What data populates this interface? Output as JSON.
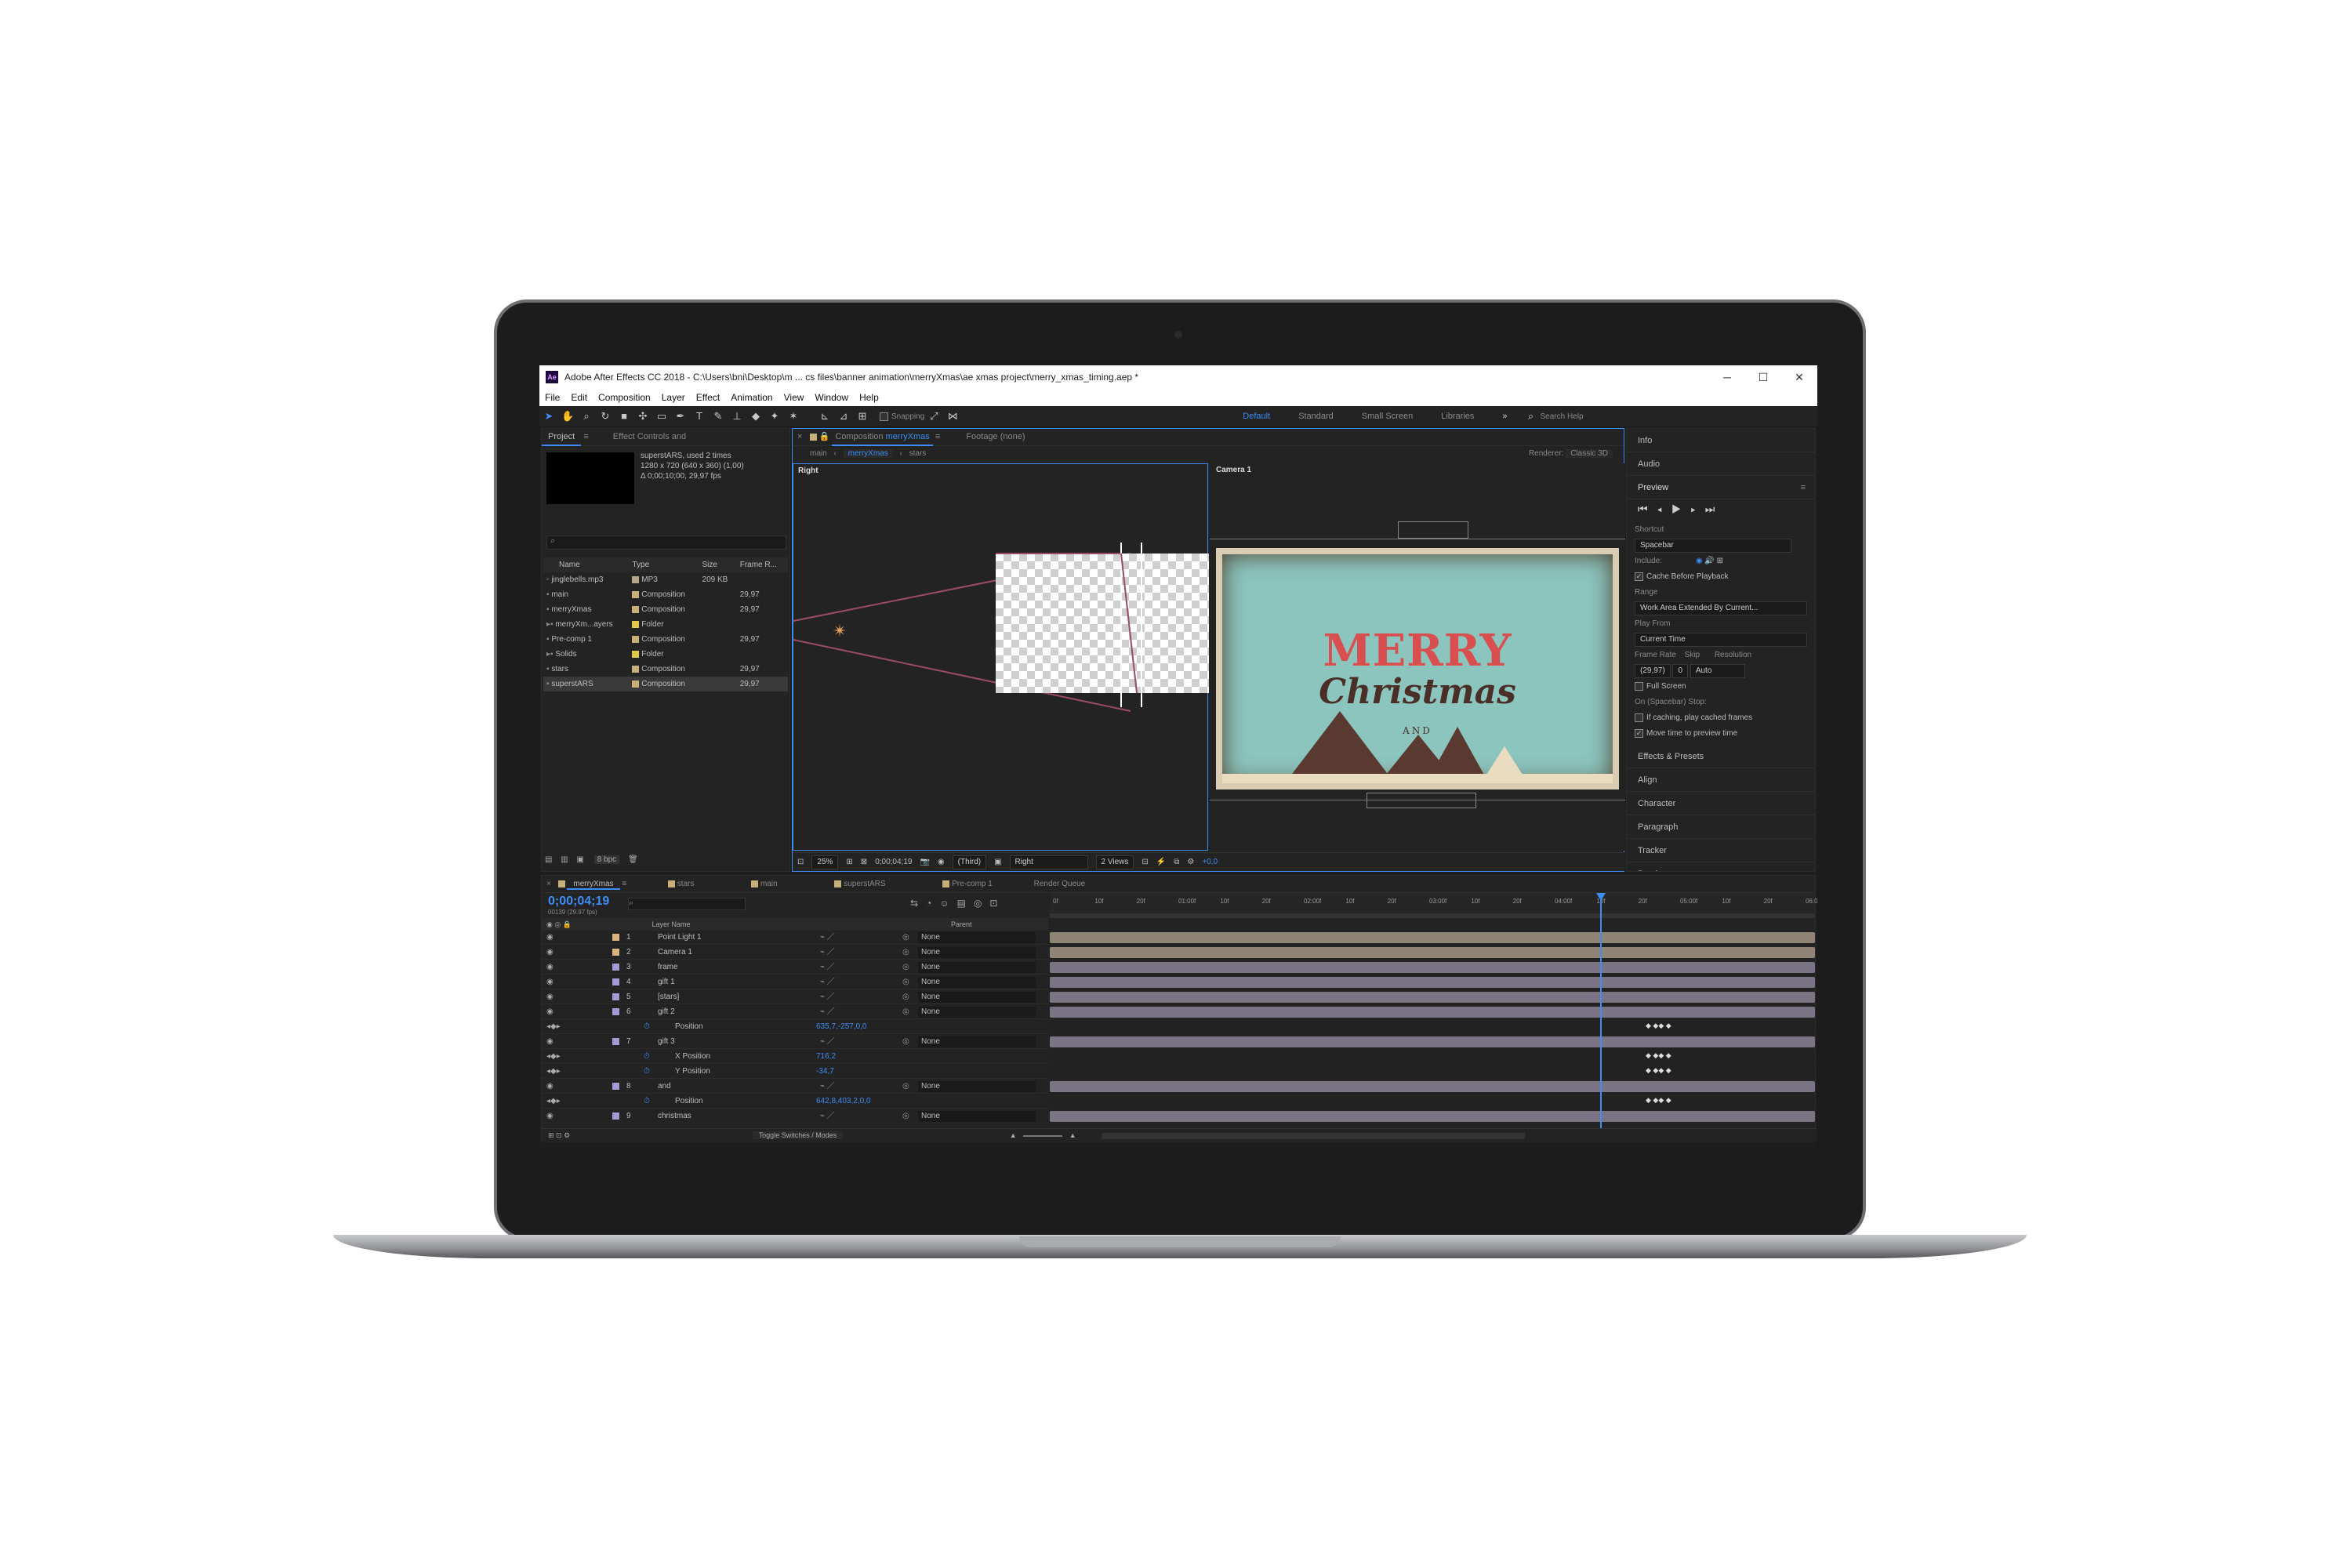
{
  "window": {
    "title": "Adobe After Effects CC 2018 - C:\\Users\\bni\\Desktop\\m ... cs files\\banner animation\\merryXmas\\ae xmas project\\merry_xmas_timing.aep *",
    "logo": "Ae",
    "minimize": "─",
    "maximize": "☐",
    "close": "✕"
  },
  "menu": [
    "File",
    "Edit",
    "Composition",
    "Layer",
    "Effect",
    "Animation",
    "View",
    "Window",
    "Help"
  ],
  "toolbar": {
    "snapping": "Snapping",
    "workspaces": [
      "Default",
      "Standard",
      "Small Screen",
      "Libraries"
    ],
    "more": "»",
    "search": "Search Help"
  },
  "project": {
    "tab": "Project",
    "effect_tab": "Effect Controls and",
    "item_name": "superstARS",
    "item_used": ", used 2 times",
    "item_size": "1280 x 720  (640 x 360) (1,00)",
    "item_dur": "Δ 0;00;10;00, 29,97 fps",
    "search_placeholder": "",
    "columns": [
      "Name",
      "Type",
      "Size",
      "Frame R..."
    ],
    "rows": [
      {
        "name": "jinglebells.mp3",
        "type": "MP3",
        "size": "209 KB",
        "fr": "",
        "color": "#b5a58a"
      },
      {
        "name": "main",
        "type": "Composition",
        "size": "",
        "fr": "29,97",
        "color": "#c9b07a"
      },
      {
        "name": "merryXmas",
        "type": "Composition",
        "size": "",
        "fr": "29,97",
        "color": "#c9b07a"
      },
      {
        "name": "merryXm...ayers",
        "type": "Folder",
        "size": "",
        "fr": "",
        "color": "#e0c84a"
      },
      {
        "name": "Pre-comp 1",
        "type": "Composition",
        "size": "",
        "fr": "29,97",
        "color": "#c9b07a"
      },
      {
        "name": "Solids",
        "type": "Folder",
        "size": "",
        "fr": "",
        "color": "#e0c84a"
      },
      {
        "name": "stars",
        "type": "Composition",
        "size": "",
        "fr": "29,97",
        "color": "#c9b07a"
      },
      {
        "name": "superstARS",
        "type": "Composition",
        "size": "",
        "fr": "29,97",
        "color": "#c9b07a"
      }
    ],
    "bpc": "8 bpc"
  },
  "comp": {
    "tab_prefix": "Composition",
    "tab_name": "merryXmas",
    "footage": "Footage  (none)",
    "crumbs": [
      "main",
      "merryXmas",
      "stars"
    ],
    "renderer_label": "Renderer:",
    "renderer": "Classic 3D",
    "view_left": "Right",
    "view_right": "Camera 1",
    "merry": "MERRY",
    "christmas": "Christmas",
    "and": "AND",
    "footer": {
      "zoom": "25%",
      "time": "0;00;04;19",
      "quality": "(Third)",
      "view": "Right",
      "views": "2 Views",
      "exposure": "+0,0"
    }
  },
  "right": {
    "info": "Info",
    "audio": "Audio",
    "preview": "Preview",
    "shortcut_label": "Shortcut",
    "shortcut": "Spacebar",
    "include": "Include:",
    "cache": "Cache Before Playback",
    "range_label": "Range",
    "range": "Work Area Extended By Current...",
    "play_from_label": "Play From",
    "play_from": "Current Time",
    "frame_rate_label": "Frame Rate",
    "skip_label": "Skip",
    "resolution_label": "Resolution",
    "frame_rate": "(29,97)",
    "skip": "0",
    "resolution": "Auto",
    "full_screen": "Full Screen",
    "on_stop": "On (Spacebar) Stop:",
    "if_caching": "If caching, play cached frames",
    "move_time": "Move time to preview time",
    "panels": [
      "Effects & Presets",
      "Align",
      "Character",
      "Paragraph",
      "Tracker",
      "Brushes"
    ]
  },
  "timeline": {
    "tabs": [
      "merryXmas",
      "stars",
      "main",
      "superstARS",
      "Pre-comp 1",
      "Render Queue"
    ],
    "timecode": "0;00;04;19",
    "fps": "00139 (29.97 fps)",
    "col_layer": "Layer Name",
    "col_parent": "Parent",
    "ruler": [
      "0f",
      "10f",
      "20f",
      "01:00f",
      "10f",
      "20f",
      "02:00f",
      "10f",
      "20f",
      "03:00f",
      "10f",
      "20f",
      "04:00f",
      "10f",
      "20f",
      "05:00f",
      "10f",
      "20f",
      "06:00f"
    ],
    "rows": [
      {
        "num": "1",
        "name": "Point Light 1",
        "parent": "None",
        "color": "#d9b380",
        "kind": "layer"
      },
      {
        "num": "2",
        "name": "Camera 1",
        "parent": "None",
        "color": "#d9b380",
        "kind": "layer"
      },
      {
        "num": "3",
        "name": "frame",
        "parent": "None",
        "color": "#a59ad6",
        "kind": "layer"
      },
      {
        "num": "4",
        "name": "gift 1",
        "parent": "None",
        "color": "#a59ad6",
        "kind": "layer"
      },
      {
        "num": "5",
        "name": "[stars]",
        "parent": "None",
        "color": "#a59ad6",
        "kind": "layer"
      },
      {
        "num": "6",
        "name": "gift 2",
        "parent": "None",
        "color": "#a59ad6",
        "kind": "layer"
      },
      {
        "num": "",
        "name": "Position",
        "value": "635,7,-257,0,0",
        "kind": "prop"
      },
      {
        "num": "7",
        "name": "gift 3",
        "parent": "None",
        "color": "#a59ad6",
        "kind": "layer"
      },
      {
        "num": "",
        "name": "X Position",
        "value": "716,2",
        "kind": "prop"
      },
      {
        "num": "",
        "name": "Y Position",
        "value": "-34,7",
        "kind": "prop"
      },
      {
        "num": "8",
        "name": "and",
        "parent": "None",
        "color": "#a59ad6",
        "kind": "layer"
      },
      {
        "num": "",
        "name": "Position",
        "value": "642,8,403,2,0,0",
        "kind": "prop"
      },
      {
        "num": "9",
        "name": "christmas",
        "parent": "None",
        "color": "#a59ad6",
        "kind": "layer"
      }
    ],
    "toggle": "Toggle Switches / Modes"
  },
  "colors": {
    "accent": "#3d8df5",
    "panel": "#232323",
    "bar": "#7a7484"
  }
}
